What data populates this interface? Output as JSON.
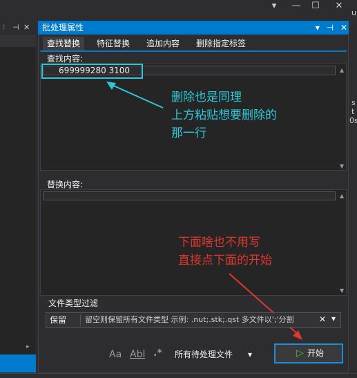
{
  "window": {
    "minimize_glyph": "▾",
    "min_glyph": "—",
    "max_glyph": "☐",
    "close_glyph": "✕",
    "edge_u": "u",
    "edge_s": "s",
    "edge_t": "t",
    "edge_0s": "0s",
    "edge_dot": ","
  },
  "left_panel": {
    "pin_glyph": "⊣",
    "close_glyph": "✕",
    "dots": "⁞",
    "scroll_arrow": "▸"
  },
  "dialog": {
    "title": "批处理属性",
    "title_dropdown": "▾",
    "title_pin": "⊣",
    "title_close": "✕",
    "tabs": [
      "查找替换",
      "特征替换",
      "追加内容",
      "删除指定标签"
    ],
    "find_label": "查找内容:",
    "find_value": "699999280  3100",
    "replace_label": "替换内容:",
    "filter": {
      "legend": "文件类型过滤",
      "mode": "保留",
      "text": "留空则保留所有文件类型 示例: .nut;.stk;.qst 多文件以';'分割",
      "clear_glyph": "✕",
      "dropdown_glyph": "▾"
    },
    "toolbar": {
      "match_case": "Aa",
      "whole_word": "Abl",
      "regex": ".*",
      "scope": "所有待处理文件",
      "scope_dropdown": "▾",
      "start_icon": "▷",
      "start_label": "开始"
    }
  },
  "annotations": {
    "cyan": [
      "删除也是同理",
      "上方粘贴想要删除的",
      "那一行"
    ],
    "red": [
      "下面啥也不用写",
      "直接点下面的开始"
    ]
  },
  "colors": {
    "accent": "#007acc",
    "annot_cyan": "#2dc7d8",
    "annot_red": "#e0362e"
  }
}
